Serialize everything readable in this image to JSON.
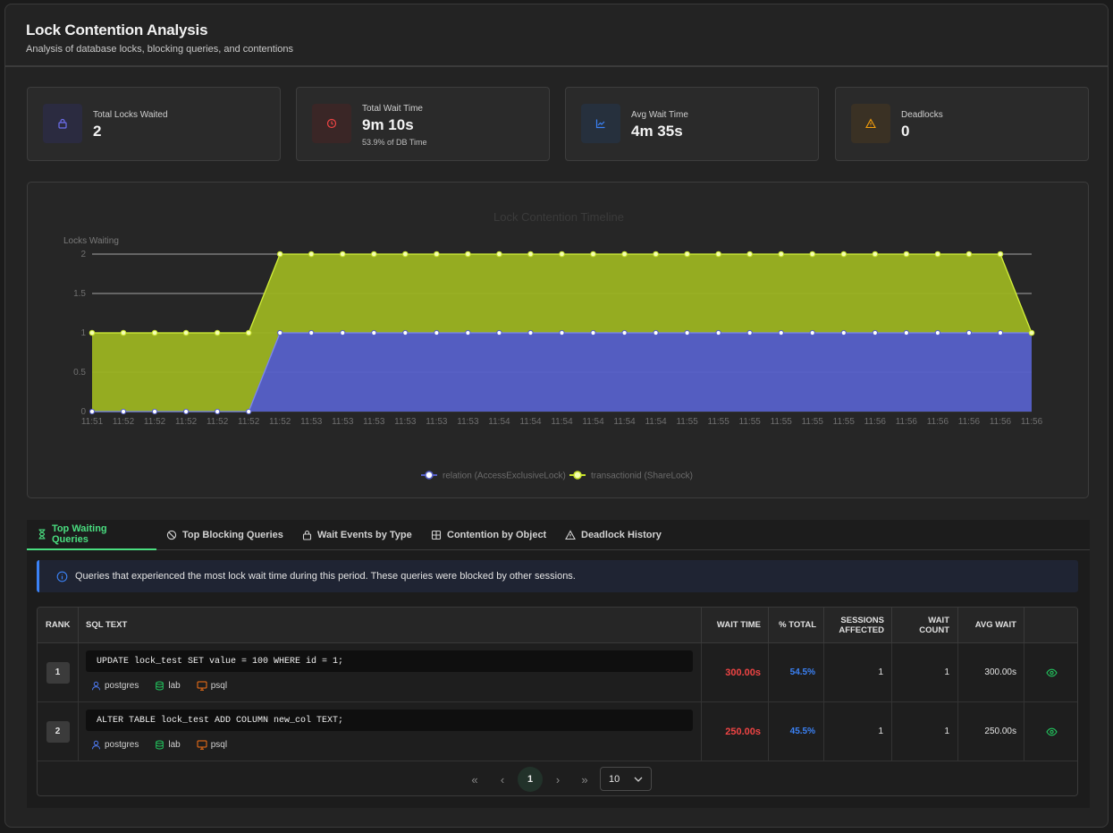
{
  "header": {
    "title": "Lock Contention Analysis",
    "subtitle": "Analysis of database locks, blocking queries, and contentions"
  },
  "stats": [
    {
      "label": "Total Locks Waited",
      "value": "2",
      "sub": "",
      "icon": "lock-icon",
      "color": "#6366f1"
    },
    {
      "label": "Total Wait Time",
      "value": "9m 10s",
      "sub": "53.9% of DB Time",
      "icon": "clock-icon",
      "color": "#ef4444"
    },
    {
      "label": "Avg Wait Time",
      "value": "4m 35s",
      "sub": "",
      "icon": "chart-line-icon",
      "color": "#3b82f6"
    },
    {
      "label": "Deadlocks",
      "value": "0",
      "sub": "",
      "icon": "warning-icon",
      "color": "#f59e0b"
    }
  ],
  "chart_data": {
    "type": "area",
    "stacked": true,
    "title": "Lock Contention Timeline",
    "ylabel": "Locks Waiting",
    "xlabel": "",
    "ylim": [
      0,
      2
    ],
    "yticks": [
      "0",
      "0.5",
      "1",
      "1.5",
      "2"
    ],
    "grid": true,
    "legend_position": "bottom",
    "categories": [
      "11:51",
      "11:52",
      "11:52",
      "11:52",
      "11:52",
      "11:52",
      "11:52",
      "11:53",
      "11:53",
      "11:53",
      "11:53",
      "11:53",
      "11:53",
      "11:54",
      "11:54",
      "11:54",
      "11:54",
      "11:54",
      "11:54",
      "11:55",
      "11:55",
      "11:55",
      "11:55",
      "11:55",
      "11:55",
      "11:56",
      "11:56",
      "11:56",
      "11:56",
      "11:56",
      "11:56"
    ],
    "series": [
      {
        "name": "relation (AccessExclusiveLock)",
        "color": "#5660c9",
        "values": [
          0,
          0,
          0,
          0,
          0,
          0,
          1,
          1,
          1,
          1,
          1,
          1,
          1,
          1,
          1,
          1,
          1,
          1,
          1,
          1,
          1,
          1,
          1,
          1,
          1,
          1,
          1,
          1,
          1,
          1,
          1
        ]
      },
      {
        "name": "transactionid (ShareLock)",
        "color": "#9bb321",
        "values": [
          1,
          1,
          1,
          1,
          1,
          1,
          1,
          1,
          1,
          1,
          1,
          1,
          1,
          1,
          1,
          1,
          1,
          1,
          1,
          1,
          1,
          1,
          1,
          1,
          1,
          1,
          1,
          1,
          1,
          1,
          0
        ]
      }
    ]
  },
  "tabs": [
    {
      "label": "Top Waiting Queries",
      "icon": "hourglass-icon",
      "active": true
    },
    {
      "label": "Top Blocking Queries",
      "icon": "block-icon",
      "active": false
    },
    {
      "label": "Wait Events by Type",
      "icon": "lock-icon",
      "active": false
    },
    {
      "label": "Contention by Object",
      "icon": "grid-icon",
      "active": false
    },
    {
      "label": "Deadlock History",
      "icon": "warning-icon",
      "active": false
    }
  ],
  "info_text": "Queries that experienced the most lock wait time during this period. These queries were blocked by other sessions.",
  "table": {
    "headers": {
      "rank": "RANK",
      "sql": "SQL TEXT",
      "wait_time": "WAIT TIME",
      "pct_total": "% TOTAL",
      "sessions_1": "SESSIONS",
      "sessions_2": "AFFECTED",
      "count_1": "WAIT",
      "count_2": "COUNT",
      "avg_wait": "AVG WAIT"
    },
    "rows": [
      {
        "rank": "1",
        "sql": "UPDATE lock_test SET value = 100 WHERE id = 1;",
        "user": "postgres",
        "db": "lab",
        "app": "psql",
        "wait_time": "300.00s",
        "pct": "54.5%",
        "sessions": "1",
        "count": "1",
        "avg": "300.00s"
      },
      {
        "rank": "2",
        "sql": "ALTER TABLE lock_test ADD COLUMN new_col TEXT;",
        "user": "postgres",
        "db": "lab",
        "app": "psql",
        "wait_time": "250.00s",
        "pct": "45.5%",
        "sessions": "1",
        "count": "1",
        "avg": "250.00s"
      }
    ]
  },
  "pagination": {
    "first": "«",
    "prev": "‹",
    "current": "1",
    "next": "›",
    "last": "»",
    "page_size": "10"
  },
  "colors": {
    "accent_green": "#4ade80",
    "wait_time_red": "#ef4444",
    "pct_blue": "#3b82f6"
  }
}
